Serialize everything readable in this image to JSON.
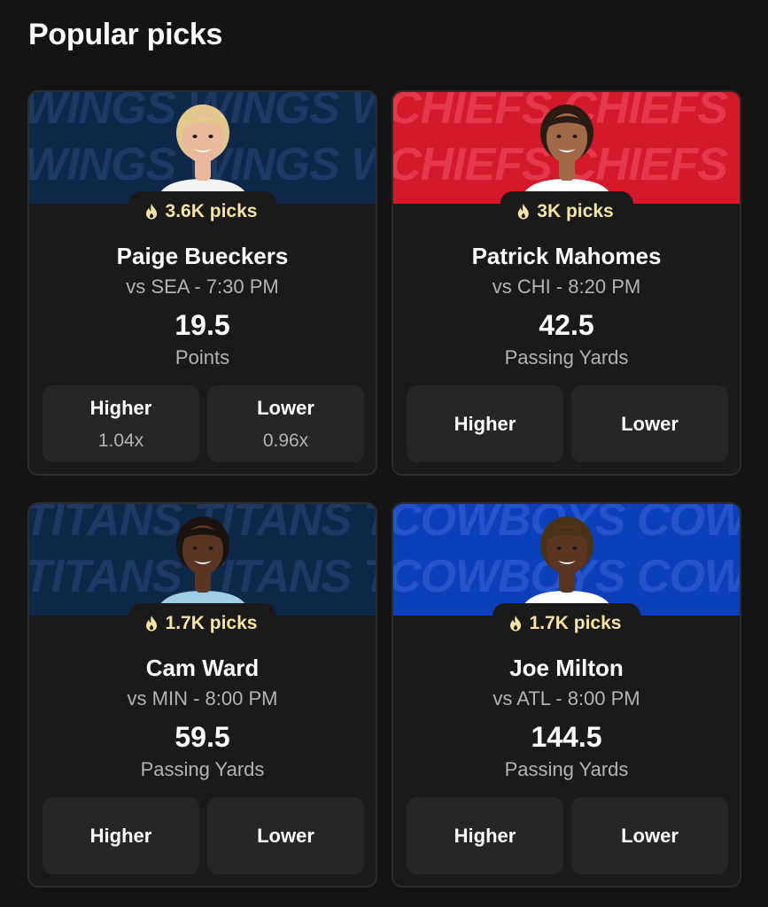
{
  "section": {
    "title": "Popular picks"
  },
  "cards": [
    {
      "team_banner": "WINGS",
      "banner_color": "#0f2748",
      "banner_text_color": "#1e3a62",
      "jersey_color": "#f3f3f3",
      "skin_color": "#e8b99b",
      "hair_color": "#e3c88d",
      "picks": "3.6K picks",
      "name": "Paige Bueckers",
      "matchup": "vs SEA - 7:30 PM",
      "line": "19.5",
      "stat": "Points",
      "higher": {
        "label": "Higher",
        "multiplier": "1.04x"
      },
      "lower": {
        "label": "Lower",
        "multiplier": "0.96x"
      }
    },
    {
      "team_banner": "CHIEFS",
      "banner_color": "#d21a2c",
      "banner_text_color": "#e5384a",
      "jersey_color": "#ffffff",
      "skin_color": "#a06a48",
      "hair_color": "#2a1c14",
      "picks": "3K picks",
      "name": "Patrick Mahomes",
      "matchup": "vs CHI - 8:20 PM",
      "line": "42.5",
      "stat": "Passing Yards",
      "higher": {
        "label": "Higher"
      },
      "lower": {
        "label": "Lower"
      }
    },
    {
      "team_banner": "TITANS",
      "banner_color": "#0f2748",
      "banner_text_color": "#1e3a62",
      "jersey_color": "#9fcde8",
      "skin_color": "#5a3524",
      "hair_color": "#1a120d",
      "picks": "1.7K picks",
      "name": "Cam Ward",
      "matchup": "vs MIN - 8:00 PM",
      "line": "59.5",
      "stat": "Passing Yards",
      "higher": {
        "label": "Higher"
      },
      "lower": {
        "label": "Lower"
      }
    },
    {
      "team_banner": "COWBOYS",
      "banner_color": "#0d3fb8",
      "banner_text_color": "#2454cc",
      "jersey_color": "#ffffff",
      "skin_color": "#5c3422",
      "hair_color": "#4a3216",
      "picks": "1.7K picks",
      "name": "Joe Milton",
      "matchup": "vs ATL - 8:00 PM",
      "line": "144.5",
      "stat": "Passing Yards",
      "higher": {
        "label": "Higher"
      },
      "lower": {
        "label": "Lower"
      }
    }
  ]
}
